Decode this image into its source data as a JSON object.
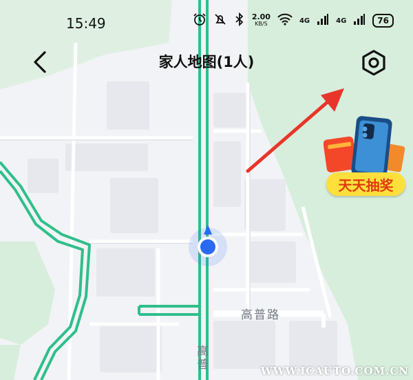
{
  "status_bar": {
    "time": "15:49",
    "net_speed_value": "2.00",
    "net_speed_unit": "KB/S",
    "signal_1": "4G",
    "signal_2": "4G",
    "battery": "76",
    "icons": [
      "alarm-icon",
      "mute-icon",
      "bluetooth-icon",
      "wifi-icon",
      "signal-icon"
    ]
  },
  "nav": {
    "title": "家人地图(1人)",
    "back_icon": "chevron-left-icon",
    "settings_icon": "hexagon-settings-icon"
  },
  "promo": {
    "label": "天天抽奖"
  },
  "map": {
    "road_label_horizontal": "高普路",
    "road_label_vertical": "高普",
    "route_color": "#2fbf8a",
    "marker_color": "#2a6af0",
    "annotation_arrow_color": "#e8352a"
  },
  "watermark": "WWW.ICAUTO.COM.CN"
}
